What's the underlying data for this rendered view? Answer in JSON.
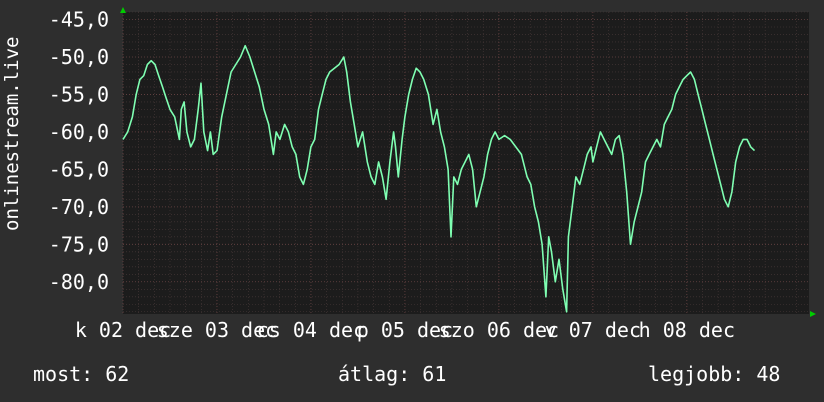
{
  "chart_data": {
    "type": "line",
    "ylabel": "onlinestream.live",
    "ylim": [
      -84.3,
      -44.0
    ],
    "yticks": [
      "-45,0",
      "-50,0",
      "-55,0",
      "-60,0",
      "-65,0",
      "-70,0",
      "-75,0",
      "-80,0"
    ],
    "ytick_values": [
      -45,
      -50,
      -55,
      -60,
      -65,
      -70,
      -75,
      -80
    ],
    "xticks": [
      "k 02 dec",
      "sze 03 dec",
      "cs 04 dec",
      "p 05 dec",
      "szo 06 dec",
      "v 07 dec",
      "h 08 dec"
    ],
    "xlim": [
      0,
      7.3
    ],
    "xtick_values": [
      0,
      1,
      2,
      3,
      4,
      5,
      6
    ],
    "grid": true,
    "colors": {
      "line": "#7fffb2",
      "plot_bg": "#1c1c1c",
      "grid": "#4a3a3a",
      "axis_arrow": "#00cc00"
    },
    "series": [
      {
        "values": [
          [
            0.0,
            -61
          ],
          [
            0.05,
            -60
          ],
          [
            0.1,
            -58
          ],
          [
            0.14,
            -55
          ],
          [
            0.18,
            -53
          ],
          [
            0.22,
            -52.5
          ],
          [
            0.26,
            -51
          ],
          [
            0.3,
            -50.5
          ],
          [
            0.34,
            -51
          ],
          [
            0.38,
            -52.5
          ],
          [
            0.42,
            -54
          ],
          [
            0.46,
            -55.5
          ],
          [
            0.5,
            -57
          ],
          [
            0.55,
            -58
          ],
          [
            0.6,
            -61
          ],
          [
            0.62,
            -57
          ],
          [
            0.65,
            -56
          ],
          [
            0.68,
            -60
          ],
          [
            0.72,
            -62
          ],
          [
            0.76,
            -61
          ],
          [
            0.8,
            -57
          ],
          [
            0.83,
            -53.5
          ],
          [
            0.86,
            -60
          ],
          [
            0.9,
            -62.5
          ],
          [
            0.93,
            -60
          ],
          [
            0.96,
            -63
          ],
          [
            1.0,
            -62.5
          ],
          [
            1.05,
            -58
          ],
          [
            1.1,
            -55
          ],
          [
            1.15,
            -52
          ],
          [
            1.2,
            -51
          ],
          [
            1.25,
            -50
          ],
          [
            1.3,
            -48.5
          ],
          [
            1.35,
            -50
          ],
          [
            1.4,
            -52
          ],
          [
            1.45,
            -54
          ],
          [
            1.5,
            -57
          ],
          [
            1.55,
            -59
          ],
          [
            1.6,
            -63
          ],
          [
            1.63,
            -60
          ],
          [
            1.67,
            -61
          ],
          [
            1.72,
            -59
          ],
          [
            1.76,
            -60
          ],
          [
            1.8,
            -62
          ],
          [
            1.84,
            -63
          ],
          [
            1.88,
            -66
          ],
          [
            1.92,
            -67
          ],
          [
            1.96,
            -65
          ],
          [
            2.0,
            -62
          ],
          [
            2.04,
            -61
          ],
          [
            2.08,
            -57
          ],
          [
            2.12,
            -55
          ],
          [
            2.16,
            -53
          ],
          [
            2.2,
            -52
          ],
          [
            2.25,
            -51.5
          ],
          [
            2.3,
            -51
          ],
          [
            2.35,
            -50
          ],
          [
            2.38,
            -52
          ],
          [
            2.42,
            -56
          ],
          [
            2.46,
            -59
          ],
          [
            2.5,
            -62
          ],
          [
            2.55,
            -60
          ],
          [
            2.6,
            -64
          ],
          [
            2.64,
            -66
          ],
          [
            2.68,
            -67
          ],
          [
            2.72,
            -64
          ],
          [
            2.76,
            -66
          ],
          [
            2.8,
            -69
          ],
          [
            2.84,
            -64
          ],
          [
            2.88,
            -60
          ],
          [
            2.9,
            -62
          ],
          [
            2.93,
            -66
          ],
          [
            2.97,
            -61
          ],
          [
            3.0,
            -58
          ],
          [
            3.04,
            -55
          ],
          [
            3.08,
            -53
          ],
          [
            3.12,
            -51.5
          ],
          [
            3.16,
            -52
          ],
          [
            3.2,
            -53
          ],
          [
            3.25,
            -55
          ],
          [
            3.3,
            -59
          ],
          [
            3.34,
            -57
          ],
          [
            3.38,
            -60
          ],
          [
            3.42,
            -62
          ],
          [
            3.46,
            -65
          ],
          [
            3.49,
            -74
          ],
          [
            3.52,
            -66
          ],
          [
            3.56,
            -67
          ],
          [
            3.6,
            -65
          ],
          [
            3.64,
            -64
          ],
          [
            3.68,
            -63
          ],
          [
            3.72,
            -65
          ],
          [
            3.76,
            -70
          ],
          [
            3.8,
            -68
          ],
          [
            3.84,
            -66
          ],
          [
            3.88,
            -63
          ],
          [
            3.92,
            -61
          ],
          [
            3.96,
            -60
          ],
          [
            4.0,
            -61
          ],
          [
            4.06,
            -60.5
          ],
          [
            4.12,
            -61
          ],
          [
            4.18,
            -62
          ],
          [
            4.24,
            -63
          ],
          [
            4.3,
            -66
          ],
          [
            4.34,
            -67
          ],
          [
            4.38,
            -70
          ],
          [
            4.42,
            -72
          ],
          [
            4.46,
            -75
          ],
          [
            4.5,
            -82
          ],
          [
            4.53,
            -74
          ],
          [
            4.56,
            -76
          ],
          [
            4.6,
            -80
          ],
          [
            4.64,
            -77
          ],
          [
            4.68,
            -81
          ],
          [
            4.72,
            -84
          ],
          [
            4.74,
            -74
          ],
          [
            4.78,
            -70
          ],
          [
            4.82,
            -66
          ],
          [
            4.86,
            -67
          ],
          [
            4.9,
            -65
          ],
          [
            4.94,
            -63
          ],
          [
            4.98,
            -62
          ],
          [
            5.0,
            -64
          ],
          [
            5.04,
            -62
          ],
          [
            5.08,
            -60
          ],
          [
            5.12,
            -61
          ],
          [
            5.16,
            -62
          ],
          [
            5.2,
            -63
          ],
          [
            5.24,
            -61
          ],
          [
            5.28,
            -60.5
          ],
          [
            5.32,
            -63
          ],
          [
            5.36,
            -68
          ],
          [
            5.4,
            -75
          ],
          [
            5.44,
            -72
          ],
          [
            5.48,
            -70
          ],
          [
            5.52,
            -68
          ],
          [
            5.56,
            -64
          ],
          [
            5.6,
            -63
          ],
          [
            5.64,
            -62
          ],
          [
            5.68,
            -61
          ],
          [
            5.72,
            -62
          ],
          [
            5.76,
            -59
          ],
          [
            5.8,
            -58
          ],
          [
            5.84,
            -57
          ],
          [
            5.88,
            -55
          ],
          [
            5.92,
            -54
          ],
          [
            5.96,
            -53
          ],
          [
            6.0,
            -52.5
          ],
          [
            6.04,
            -52
          ],
          [
            6.08,
            -53
          ],
          [
            6.12,
            -55
          ],
          [
            6.16,
            -57
          ],
          [
            6.2,
            -59
          ],
          [
            6.24,
            -61
          ],
          [
            6.28,
            -63
          ],
          [
            6.32,
            -65
          ],
          [
            6.36,
            -67
          ],
          [
            6.4,
            -69
          ],
          [
            6.44,
            -70
          ],
          [
            6.48,
            -68
          ],
          [
            6.52,
            -64
          ],
          [
            6.56,
            -62
          ],
          [
            6.6,
            -61
          ],
          [
            6.64,
            -61
          ],
          [
            6.68,
            -62
          ],
          [
            6.72,
            -62.5
          ]
        ]
      }
    ]
  },
  "footer": {
    "most_label": "most:",
    "most_value": "62",
    "atlag_label": "átlag:",
    "atlag_value": "61",
    "legjobb_label": "legjobb:",
    "legjobb_value": "48"
  }
}
